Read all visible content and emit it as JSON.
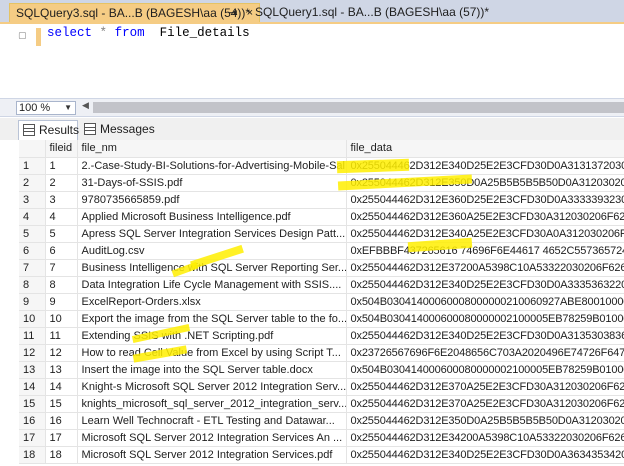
{
  "tabs": {
    "active": "SQLQuery3.sql - BA...B (BAGESH\\aa (54))*",
    "inactive": "SQLQuery1.sql - BA...B (BAGESH\\aa (57))*",
    "pin_glyph": "⇥",
    "close_glyph": "×"
  },
  "editor": {
    "kw_select": "select",
    "op_star": "*",
    "kw_from": "from",
    "table": "File_details"
  },
  "zoom": {
    "value": "100 %"
  },
  "results_tabs": {
    "results": "Results",
    "messages": "Messages"
  },
  "grid": {
    "headers": [
      "fileid",
      "file_nm",
      "file_data"
    ],
    "rows": [
      {
        "rn": "1",
        "fileid": "1",
        "file_nm": "2.-Case-Study-BI-Solutions-for-Advertising-Mobile-Sal...",
        "file_data": "0x255044462D312E340D25E2E3CFD30D0A3131372030206F..."
      },
      {
        "rn": "2",
        "fileid": "2",
        "file_nm": "31-Days-of-SSIS.pdf",
        "file_data": "0x255044462D312E350D0A25B5B5B5B50D0A312030206F62..."
      },
      {
        "rn": "3",
        "fileid": "3",
        "file_nm": "9780735665859.pdf",
        "file_data": "0x255044462D312E360D25E2E3CFD30D0A33333932303..."
      },
      {
        "rn": "4",
        "fileid": "4",
        "file_nm": "Applied Microsoft Business Intelligence.pdf",
        "file_data": "0x255044462D312E360A25E2E3CFD30A312030206F626A200..."
      },
      {
        "rn": "5",
        "fileid": "5",
        "file_nm": "Apress SQL Server Integration Services Design Patt...",
        "file_data": "0x255044462D312E340A25E2E3CFD30A0A312030206F626A..."
      },
      {
        "rn": "6",
        "fileid": "6",
        "file_nm": "AuditLog.csv",
        "file_data": "0xEFBBBF437265616 74696F6E44617 4652C557365724964732..."
      },
      {
        "rn": "7",
        "fileid": "7",
        "file_nm": "Business Intelligence with SQL Server Reporting Ser...",
        "file_data": "0x255044462D312E37200A5398C10A53322030206F626A203..."
      },
      {
        "rn": "8",
        "fileid": "8",
        "file_nm": "Data Integration Life Cycle Management with SSIS....",
        "file_data": "0x255044462D312E340D25E2E3CFD30D0A33353632203020..."
      },
      {
        "rn": "9",
        "fileid": "9",
        "file_nm": "ExcelReport-Orders.xlsx",
        "file_data": "0x504B03041400060008000000210060927ABE800100000C06..."
      },
      {
        "rn": "10",
        "fileid": "10",
        "file_nm": "Export the image from the SQL Server table to the fo...",
        "file_data": "0x504B030414000600080000002100005EB78259B01000450..."
      },
      {
        "rn": "11",
        "fileid": "11",
        "file_nm": "Extending SSIS with .NET Scripting.pdf",
        "file_data": "0x255044462D312E340D25E2E3CFD30D0A31353038362030..."
      },
      {
        "rn": "12",
        "fileid": "12",
        "file_nm": "How to read Cell Value from Excel by using Script T...",
        "file_data": "0x23726567696F6E2048656C703A2020496E74726F647563..."
      },
      {
        "rn": "13",
        "fileid": "13",
        "file_nm": "Insert the image into the SQL Server table.docx",
        "file_data": "0x504B030414000600080000002100005EB78259B010004506..."
      },
      {
        "rn": "14",
        "fileid": "14",
        "file_nm": "Knight-s Microsoft SQL Server 2012 Integration Serv...",
        "file_data": "0x255044462D312E370A25E2E3CFD30A312030206F626A200..."
      },
      {
        "rn": "15",
        "fileid": "15",
        "file_nm": "knights_microsoft_sql_server_2012_integration_serv...",
        "file_data": "0x255044462D312E370A25E2E3CFD30A312030206F626A0A3..."
      },
      {
        "rn": "16",
        "fileid": "16",
        "file_nm": "Learn Well Technocraft - ETL Testing and Datawar...",
        "file_data": "0x255044462D312E350D0A25B5B5B5B50D0A312030206F62..."
      },
      {
        "rn": "17",
        "fileid": "17",
        "file_nm": "Microsoft SQL Server 2012 Integration Services An ...",
        "file_data": "0x255044462D312E34200A5398C10A53322030206F626A203..."
      },
      {
        "rn": "18",
        "fileid": "18",
        "file_nm": "Microsoft SQL Server 2012 Integration Services.pdf",
        "file_data": "0x255044462D312E340D25E2E3CFD30D0A36343534203020..."
      }
    ]
  }
}
